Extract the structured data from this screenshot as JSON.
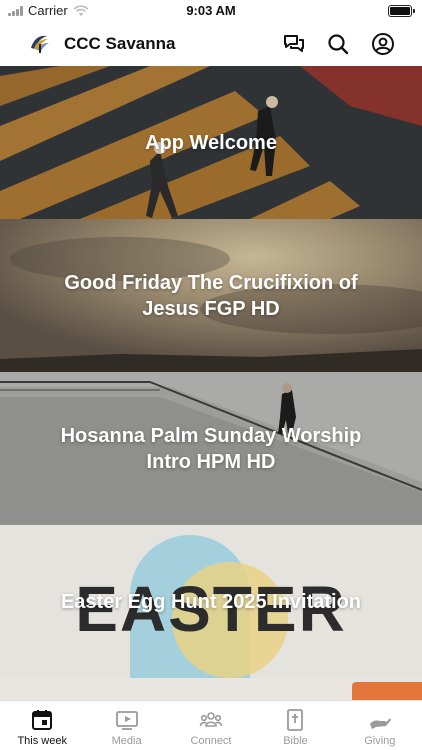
{
  "status_bar": {
    "carrier": "Carrier",
    "time": "9:03 AM"
  },
  "header": {
    "title": "CCC Savanna",
    "icons": [
      "chat-icon",
      "search-icon",
      "profile-icon"
    ]
  },
  "feed": {
    "items": [
      {
        "title": "App Welcome"
      },
      {
        "title": "Good Friday The Crucifixion of Jesus FGP HD"
      },
      {
        "title": "Hosanna Palm Sunday Worship Intro HPM HD"
      },
      {
        "title": "Easter Egg Hunt 2025 Invitation",
        "image_text": "EASTER"
      }
    ]
  },
  "tab_bar": {
    "tabs": [
      {
        "label": "This week",
        "icon": "calendar-icon",
        "active": true
      },
      {
        "label": "Media",
        "icon": "play-icon",
        "active": false
      },
      {
        "label": "Connect",
        "icon": "people-icon",
        "active": false
      },
      {
        "label": "Bible",
        "icon": "bible-icon",
        "active": false
      },
      {
        "label": "Giving",
        "icon": "hand-icon",
        "active": false
      }
    ]
  },
  "colors": {
    "active_tab": "#111111",
    "inactive_tab": "#9a9a9a",
    "easter_blue": "#8fc9d9",
    "easter_yellow": "#e8cf7b"
  }
}
